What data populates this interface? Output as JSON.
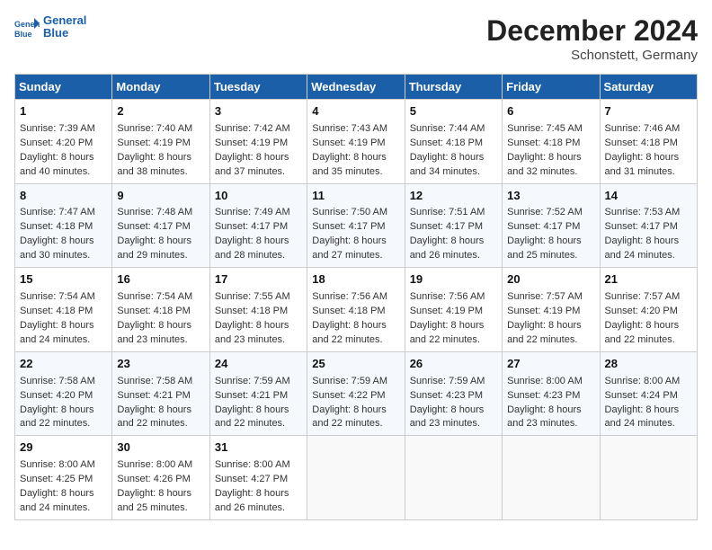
{
  "header": {
    "logo_line1": "General",
    "logo_line2": "Blue",
    "month_title": "December 2024",
    "location": "Schonstett, Germany"
  },
  "weekdays": [
    "Sunday",
    "Monday",
    "Tuesday",
    "Wednesday",
    "Thursday",
    "Friday",
    "Saturday"
  ],
  "weeks": [
    [
      {
        "day": "1",
        "lines": [
          "Sunrise: 7:39 AM",
          "Sunset: 4:20 PM",
          "Daylight: 8 hours",
          "and 40 minutes."
        ]
      },
      {
        "day": "2",
        "lines": [
          "Sunrise: 7:40 AM",
          "Sunset: 4:19 PM",
          "Daylight: 8 hours",
          "and 38 minutes."
        ]
      },
      {
        "day": "3",
        "lines": [
          "Sunrise: 7:42 AM",
          "Sunset: 4:19 PM",
          "Daylight: 8 hours",
          "and 37 minutes."
        ]
      },
      {
        "day": "4",
        "lines": [
          "Sunrise: 7:43 AM",
          "Sunset: 4:19 PM",
          "Daylight: 8 hours",
          "and 35 minutes."
        ]
      },
      {
        "day": "5",
        "lines": [
          "Sunrise: 7:44 AM",
          "Sunset: 4:18 PM",
          "Daylight: 8 hours",
          "and 34 minutes."
        ]
      },
      {
        "day": "6",
        "lines": [
          "Sunrise: 7:45 AM",
          "Sunset: 4:18 PM",
          "Daylight: 8 hours",
          "and 32 minutes."
        ]
      },
      {
        "day": "7",
        "lines": [
          "Sunrise: 7:46 AM",
          "Sunset: 4:18 PM",
          "Daylight: 8 hours",
          "and 31 minutes."
        ]
      }
    ],
    [
      {
        "day": "8",
        "lines": [
          "Sunrise: 7:47 AM",
          "Sunset: 4:18 PM",
          "Daylight: 8 hours",
          "and 30 minutes."
        ]
      },
      {
        "day": "9",
        "lines": [
          "Sunrise: 7:48 AM",
          "Sunset: 4:17 PM",
          "Daylight: 8 hours",
          "and 29 minutes."
        ]
      },
      {
        "day": "10",
        "lines": [
          "Sunrise: 7:49 AM",
          "Sunset: 4:17 PM",
          "Daylight: 8 hours",
          "and 28 minutes."
        ]
      },
      {
        "day": "11",
        "lines": [
          "Sunrise: 7:50 AM",
          "Sunset: 4:17 PM",
          "Daylight: 8 hours",
          "and 27 minutes."
        ]
      },
      {
        "day": "12",
        "lines": [
          "Sunrise: 7:51 AM",
          "Sunset: 4:17 PM",
          "Daylight: 8 hours",
          "and 26 minutes."
        ]
      },
      {
        "day": "13",
        "lines": [
          "Sunrise: 7:52 AM",
          "Sunset: 4:17 PM",
          "Daylight: 8 hours",
          "and 25 minutes."
        ]
      },
      {
        "day": "14",
        "lines": [
          "Sunrise: 7:53 AM",
          "Sunset: 4:17 PM",
          "Daylight: 8 hours",
          "and 24 minutes."
        ]
      }
    ],
    [
      {
        "day": "15",
        "lines": [
          "Sunrise: 7:54 AM",
          "Sunset: 4:18 PM",
          "Daylight: 8 hours",
          "and 24 minutes."
        ]
      },
      {
        "day": "16",
        "lines": [
          "Sunrise: 7:54 AM",
          "Sunset: 4:18 PM",
          "Daylight: 8 hours",
          "and 23 minutes."
        ]
      },
      {
        "day": "17",
        "lines": [
          "Sunrise: 7:55 AM",
          "Sunset: 4:18 PM",
          "Daylight: 8 hours",
          "and 23 minutes."
        ]
      },
      {
        "day": "18",
        "lines": [
          "Sunrise: 7:56 AM",
          "Sunset: 4:18 PM",
          "Daylight: 8 hours",
          "and 22 minutes."
        ]
      },
      {
        "day": "19",
        "lines": [
          "Sunrise: 7:56 AM",
          "Sunset: 4:19 PM",
          "Daylight: 8 hours",
          "and 22 minutes."
        ]
      },
      {
        "day": "20",
        "lines": [
          "Sunrise: 7:57 AM",
          "Sunset: 4:19 PM",
          "Daylight: 8 hours",
          "and 22 minutes."
        ]
      },
      {
        "day": "21",
        "lines": [
          "Sunrise: 7:57 AM",
          "Sunset: 4:20 PM",
          "Daylight: 8 hours",
          "and 22 minutes."
        ]
      }
    ],
    [
      {
        "day": "22",
        "lines": [
          "Sunrise: 7:58 AM",
          "Sunset: 4:20 PM",
          "Daylight: 8 hours",
          "and 22 minutes."
        ]
      },
      {
        "day": "23",
        "lines": [
          "Sunrise: 7:58 AM",
          "Sunset: 4:21 PM",
          "Daylight: 8 hours",
          "and 22 minutes."
        ]
      },
      {
        "day": "24",
        "lines": [
          "Sunrise: 7:59 AM",
          "Sunset: 4:21 PM",
          "Daylight: 8 hours",
          "and 22 minutes."
        ]
      },
      {
        "day": "25",
        "lines": [
          "Sunrise: 7:59 AM",
          "Sunset: 4:22 PM",
          "Daylight: 8 hours",
          "and 22 minutes."
        ]
      },
      {
        "day": "26",
        "lines": [
          "Sunrise: 7:59 AM",
          "Sunset: 4:23 PM",
          "Daylight: 8 hours",
          "and 23 minutes."
        ]
      },
      {
        "day": "27",
        "lines": [
          "Sunrise: 8:00 AM",
          "Sunset: 4:23 PM",
          "Daylight: 8 hours",
          "and 23 minutes."
        ]
      },
      {
        "day": "28",
        "lines": [
          "Sunrise: 8:00 AM",
          "Sunset: 4:24 PM",
          "Daylight: 8 hours",
          "and 24 minutes."
        ]
      }
    ],
    [
      {
        "day": "29",
        "lines": [
          "Sunrise: 8:00 AM",
          "Sunset: 4:25 PM",
          "Daylight: 8 hours",
          "and 24 minutes."
        ]
      },
      {
        "day": "30",
        "lines": [
          "Sunrise: 8:00 AM",
          "Sunset: 4:26 PM",
          "Daylight: 8 hours",
          "and 25 minutes."
        ]
      },
      {
        "day": "31",
        "lines": [
          "Sunrise: 8:00 AM",
          "Sunset: 4:27 PM",
          "Daylight: 8 hours",
          "and 26 minutes."
        ]
      },
      null,
      null,
      null,
      null
    ]
  ]
}
